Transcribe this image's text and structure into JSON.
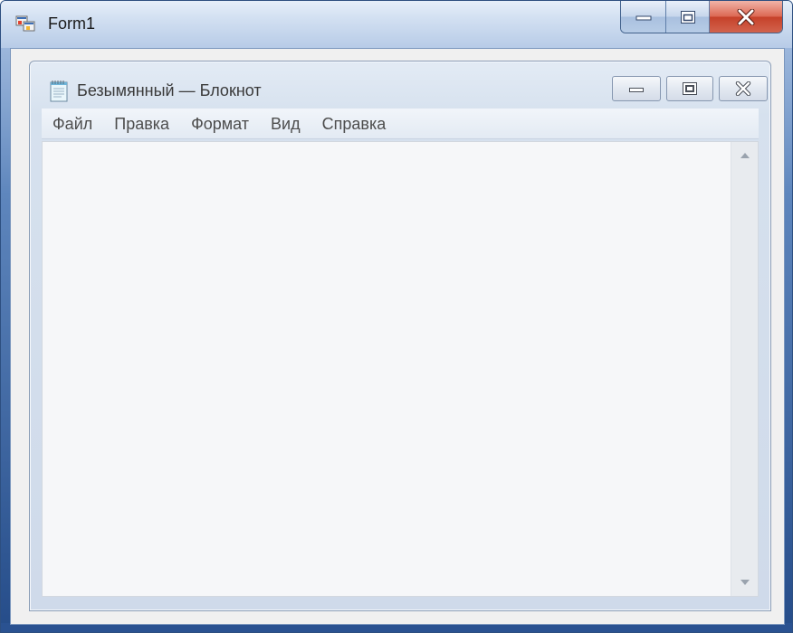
{
  "form": {
    "title": "Form1",
    "icon": "winforms-app-icon"
  },
  "notepad": {
    "title": "Безымянный — Блокнот",
    "icon": "notepad-icon",
    "menu": [
      {
        "label": "Файл"
      },
      {
        "label": "Правка"
      },
      {
        "label": "Формат"
      },
      {
        "label": "Вид"
      },
      {
        "label": "Справка"
      }
    ],
    "content": ""
  },
  "colors": {
    "close_accent": "#c6412a",
    "frame_blue": "#2a5291"
  }
}
